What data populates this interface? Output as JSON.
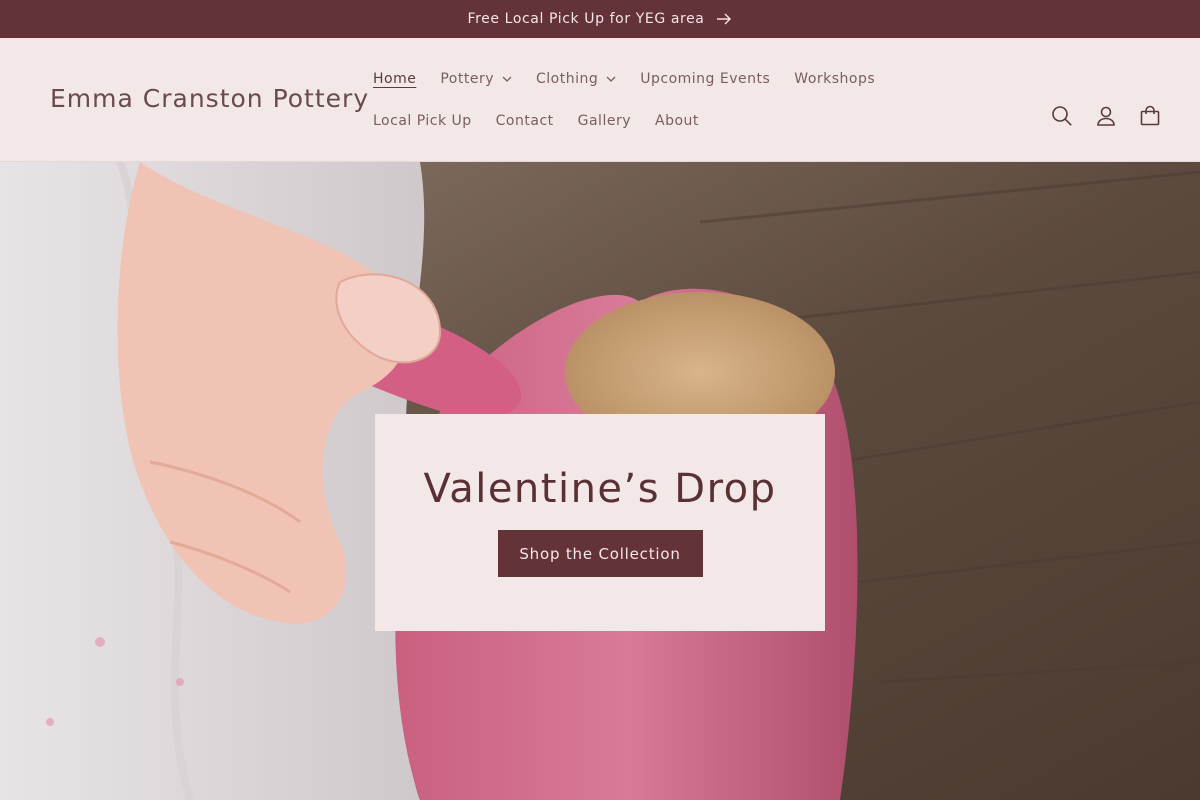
{
  "announcement": {
    "text": "Free Local Pick Up for YEG area",
    "icon": "arrow-right-icon"
  },
  "header": {
    "logo": "Emma Cranston Pottery",
    "nav": [
      {
        "label": "Home",
        "active": true
      },
      {
        "label": "Pottery",
        "dropdown": true
      },
      {
        "label": "Clothing",
        "dropdown": true
      },
      {
        "label": "Upcoming Events"
      },
      {
        "label": "Workshops"
      },
      {
        "label": "Local Pick Up"
      },
      {
        "label": "Contact"
      },
      {
        "label": "Gallery"
      },
      {
        "label": "About"
      }
    ],
    "icons": [
      "search-icon",
      "account-icon",
      "cart-icon"
    ]
  },
  "hero": {
    "image": "hand holding pink heart-shaped ceramic mug",
    "title": "Valentine’s Drop",
    "button": "Shop the Collection"
  },
  "colors": {
    "primary": "#643338",
    "background": "#f3e8e8",
    "text": "#5a3a3c"
  }
}
